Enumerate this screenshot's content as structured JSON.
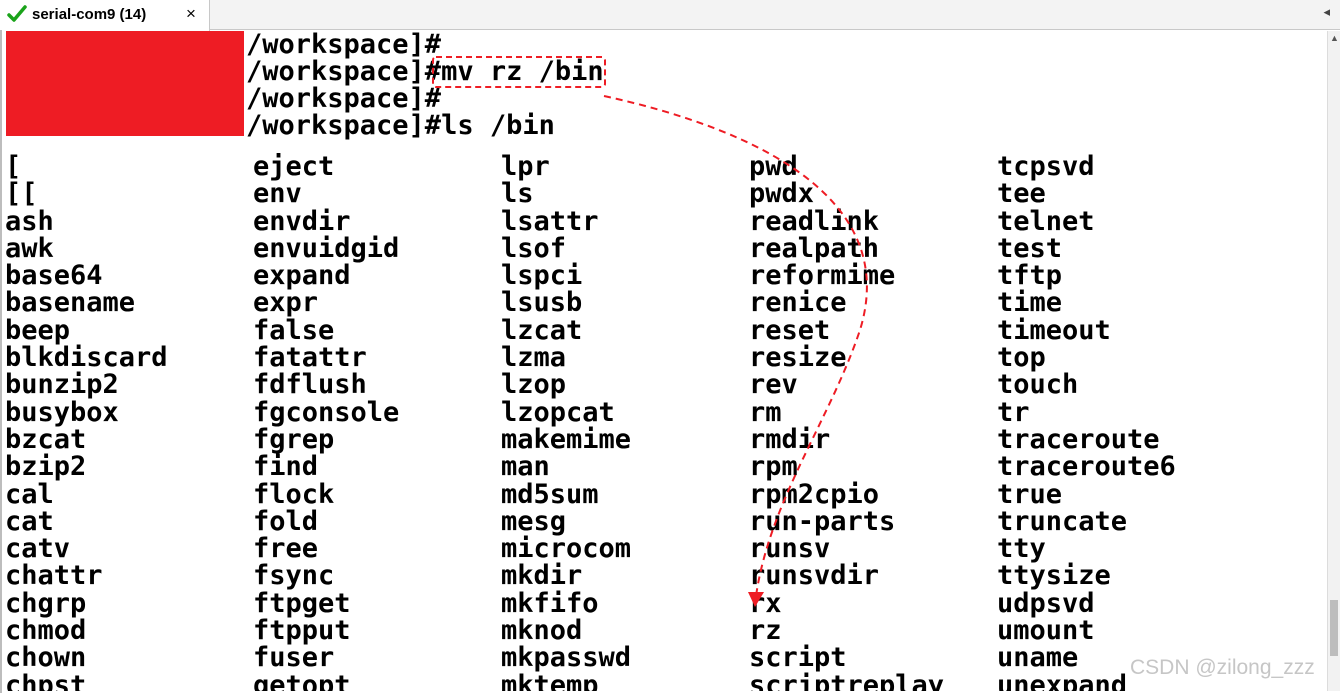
{
  "tab": {
    "title": "serial-com9 (14)",
    "close": "×",
    "nav_left": "◂"
  },
  "terminal": {
    "prompt_lines": [
      "/workspace]#",
      "/workspace]#mv rz /bin",
      "/workspace]#",
      "/workspace]#ls /bin"
    ],
    "columns": [
      [
        "[",
        "[[",
        "ash",
        "awk",
        "base64",
        "basename",
        "beep",
        "blkdiscard",
        "bunzip2",
        "busybox",
        "bzcat",
        "bzip2",
        "cal",
        "cat",
        "catv",
        "chattr",
        "chgrp",
        "chmod",
        "chown",
        "chpst"
      ],
      [
        "eject",
        "env",
        "envdir",
        "envuidgid",
        "expand",
        "expr",
        "false",
        "fatattr",
        "fdflush",
        "fgconsole",
        "fgrep",
        "find",
        "flock",
        "fold",
        "free",
        "fsync",
        "ftpget",
        "ftpput",
        "fuser",
        "getopt"
      ],
      [
        "lpr",
        "ls",
        "lsattr",
        "lsof",
        "lspci",
        "lsusb",
        "lzcat",
        "lzma",
        "lzop",
        "lzopcat",
        "makemime",
        "man",
        "md5sum",
        "mesg",
        "microcom",
        "mkdir",
        "mkfifo",
        "mknod",
        "mkpasswd",
        "mktemp"
      ],
      [
        "pwd",
        "pwdx",
        "readlink",
        "realpath",
        "reformime",
        "renice",
        "reset",
        "resize",
        "rev",
        "rm",
        "rmdir",
        "rpm",
        "rpm2cpio",
        "run-parts",
        "runsv",
        "runsvdir",
        "rx",
        "rz",
        "script",
        "scriptreplay"
      ],
      [
        "tcpsvd",
        "tee",
        "telnet",
        "test",
        "tftp",
        "time",
        "timeout",
        "top",
        "touch",
        "tr",
        "traceroute",
        "traceroute6",
        "true",
        "truncate",
        "tty",
        "ttysize",
        "udpsvd",
        "umount",
        "uname",
        "unexpand"
      ]
    ]
  },
  "annotation": {
    "highlight_command": "mv rz /bin",
    "arrow_target": "rz",
    "color": "#ee1c24"
  },
  "watermark": "CSDN @zilong_zzz",
  "colors": {
    "redaction": "#ee1c24",
    "check": "#1aa31a"
  }
}
